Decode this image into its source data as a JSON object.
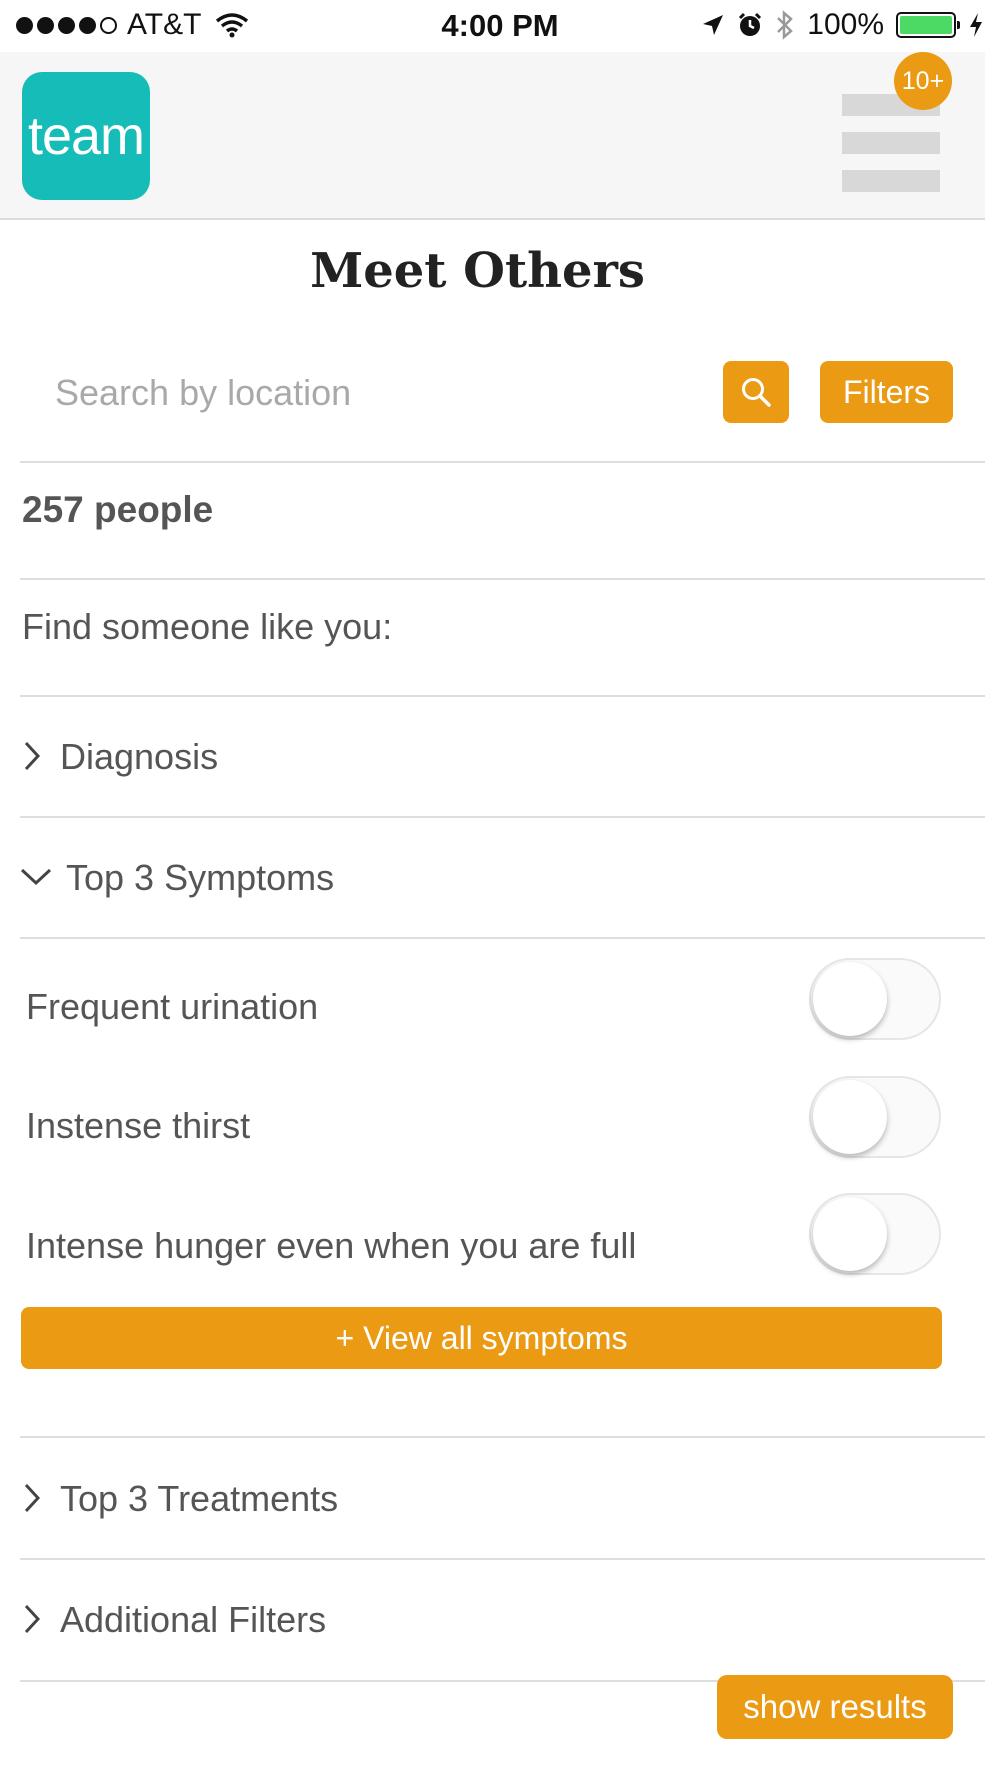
{
  "status_bar": {
    "carrier": "AT&T",
    "time": "4:00 PM",
    "battery": "100%",
    "signal_bars": 4,
    "icons": [
      "wifi-icon",
      "location-arrow-icon",
      "alarm-icon",
      "bluetooth-icon",
      "battery-icon",
      "charging-icon"
    ]
  },
  "header": {
    "logo_text": "team",
    "notification_badge": "10+",
    "menu_icon": "hamburger-menu-icon"
  },
  "page": {
    "title": "Meet Others"
  },
  "search": {
    "placeholder": "Search by location",
    "value": "",
    "search_icon": "search-icon",
    "filters_label": "Filters"
  },
  "results": {
    "count_text": "257 people",
    "prompt": "Find someone like you:"
  },
  "sections": {
    "diagnosis": {
      "label": "Diagnosis",
      "expanded": false
    },
    "symptoms": {
      "label": "Top 3 Symptoms",
      "expanded": true,
      "items": [
        {
          "label": "Frequent urination",
          "on": false
        },
        {
          "label": "Instense thirst",
          "on": false
        },
        {
          "label": "Intense hunger even when you are full",
          "on": false
        }
      ],
      "view_all_label": "+ View all symptoms"
    },
    "treatments": {
      "label": "Top 3 Treatments",
      "expanded": false
    },
    "additional": {
      "label": "Additional Filters",
      "expanded": false
    }
  },
  "actions": {
    "show_results_label": "show results"
  },
  "colors": {
    "accent": "#eb9a13",
    "brand": "#16bcb7",
    "battery": "#4cd964",
    "divider": "#dedede"
  }
}
